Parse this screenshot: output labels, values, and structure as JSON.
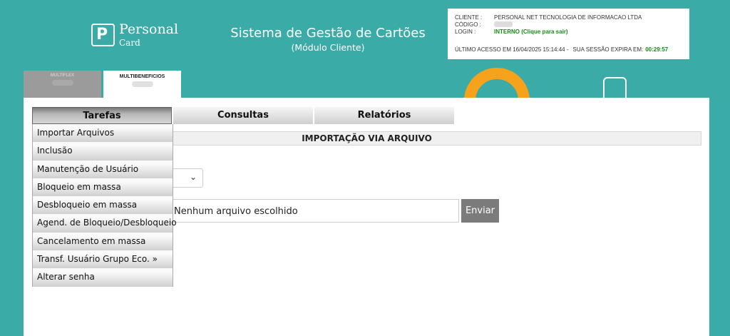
{
  "header": {
    "logo": {
      "word1": "Personal",
      "word2": "Card"
    },
    "title": "Sistema de Gestão de Cartões",
    "subtitle": "(Módulo Cliente)"
  },
  "session": {
    "cliente_label": "CLIENTE :",
    "cliente_value": "PERSONAL NET TECNOLOGIA DE INFORMACAO LTDA",
    "codigo_label": "CÓDIGO :",
    "login_label": "LOGIN :",
    "login_value": "INTERNO (Clique para sair)",
    "last_access": "ÚLTIMO ACESSO EM 16/04/2025 15:14:44 -",
    "expires_label": "SUA SESSÃO EXPIRA EM:",
    "expires_value": "00:29:57"
  },
  "tabs": [
    {
      "label": "MULTIFLEX"
    },
    {
      "label": "MULTIBENEFICIOS"
    }
  ],
  "menu": {
    "items": [
      {
        "label": "Tarefas"
      },
      {
        "label": "Consultas"
      },
      {
        "label": "Relatórios"
      }
    ],
    "tarefas_dropdown": [
      "Importar Arquivos",
      "Inclusão",
      "Manutenção de Usuário",
      "Bloqueio em massa",
      "Desbloqueio em massa",
      "Agend. de Bloqueio/Desbloqueio",
      "Cancelamento em massa",
      "Transf. Usuário Grupo Eco. »",
      "Alterar senha"
    ]
  },
  "content": {
    "section_title": "IMPORTAÇÃO VIA ARQUIVO",
    "file_text": "Nenhum arquivo escolhido",
    "send_label": "Enviar"
  },
  "colors": {
    "background": "#3aaba7",
    "accent_orange": "#f6a21a",
    "status_green": "#1a8a1a"
  }
}
